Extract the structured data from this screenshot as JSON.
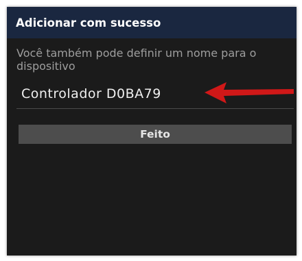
{
  "dialog": {
    "title": "Adicionar com sucesso",
    "message": "Você também pode definir um nome para o dispositivo",
    "name_field": {
      "value": "Controlador D0BA79"
    },
    "done_label": "Feito"
  },
  "colors": {
    "header_bg": "#1a2740",
    "body_bg": "#1b1b1b",
    "button_bg": "#4d4d4d",
    "annotation_arrow": "#d01818"
  },
  "icons": {
    "annotation": "red-arrow-icon"
  }
}
